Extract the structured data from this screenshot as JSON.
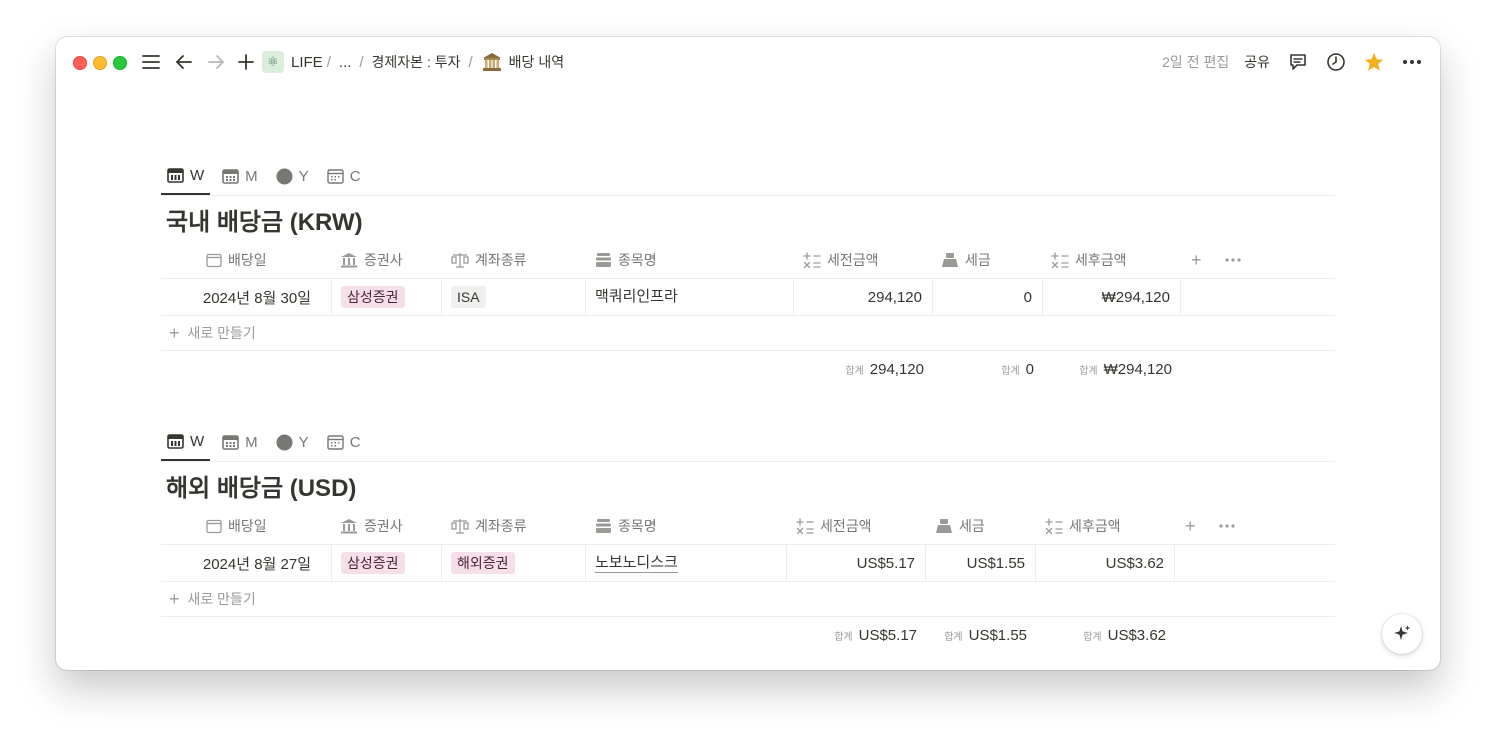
{
  "topbar": {
    "breadcrumb_root": "LIFE",
    "breadcrumb_sep": "/",
    "breadcrumb_ellipsis": "...",
    "breadcrumb_parent": "경제자본 : 투자",
    "breadcrumb_current": "배당 내역",
    "edited": "2일 전 편집",
    "share": "공유"
  },
  "view_tabs": [
    {
      "label": "W",
      "icon": "calendar-week-icon",
      "active": true
    },
    {
      "label": "M",
      "icon": "calendar-month-icon",
      "active": false
    },
    {
      "label": "Y",
      "icon": "circle-icon",
      "active": false
    },
    {
      "label": "C",
      "icon": "calendar-icon",
      "active": false
    }
  ],
  "columns": {
    "date": "배당일",
    "broker": "증권사",
    "account": "계좌종류",
    "stock": "종목명",
    "pretax": "세전금액",
    "tax": "세금",
    "aftertax": "세후금액"
  },
  "new_row_label": "새로 만들기",
  "sum_label": "합계",
  "krw": {
    "title": "국내 배당금 (KRW)",
    "rows": [
      {
        "date": "2024년 8월 30일",
        "broker": "삼성증권",
        "account": "ISA",
        "stock": "맥쿼리인프라",
        "pretax": "294,120",
        "tax": "0",
        "aftertax": "₩294,120"
      }
    ],
    "sums": {
      "pretax": "294,120",
      "tax": "0",
      "aftertax": "₩294,120"
    }
  },
  "usd": {
    "title": "해외 배당금 (USD)",
    "rows": [
      {
        "date": "2024년 8월 27일",
        "broker": "삼성증권",
        "account": "해외증권",
        "stock": "노보노디스크",
        "pretax": "US$5.17",
        "tax": "US$1.55",
        "aftertax": "US$3.62"
      }
    ],
    "sums": {
      "pretax": "US$5.17",
      "tax": "US$1.55",
      "aftertax": "US$3.62"
    }
  },
  "colors": {
    "tag_pink_bg": "#f5e0e9",
    "tag_gray_bg": "#efefed",
    "star": "#f2b01e"
  }
}
